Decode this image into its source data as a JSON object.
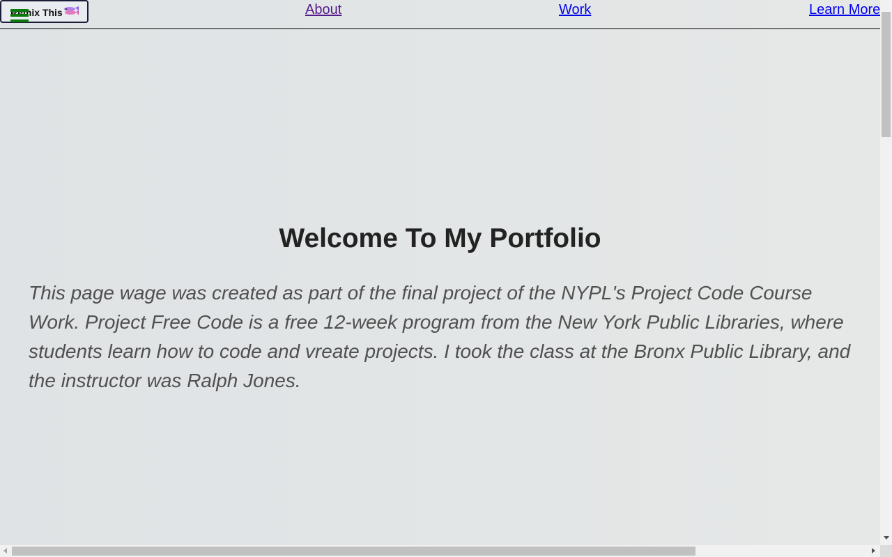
{
  "nav": {
    "remix_label": "Remix This",
    "about_label": "About",
    "work_label": "Work",
    "learn_more_label": "Learn More"
  },
  "main": {
    "title": "Welcome To My Portfolio",
    "intro": "This page wage was created as part of the final project of the NYPL's Project Code Course Work. Project Free Code is a free 12-week program from the New York Public Libraries, where students learn how to code and vreate projects. I took the class at the Bronx Public Library, and the instructor was Ralph Jones."
  },
  "icons": {
    "remix": "fish-icon",
    "menu": "hamburger-icon"
  },
  "colors": {
    "background": "#e1e5e6",
    "link": "#0000ee",
    "visited_link": "#551a8b",
    "heading": "#222222",
    "body_text": "#505050",
    "menu_icon": "#0a7a0a"
  },
  "scroll": {
    "vertical_position": 0,
    "horizontal_position": 0
  }
}
